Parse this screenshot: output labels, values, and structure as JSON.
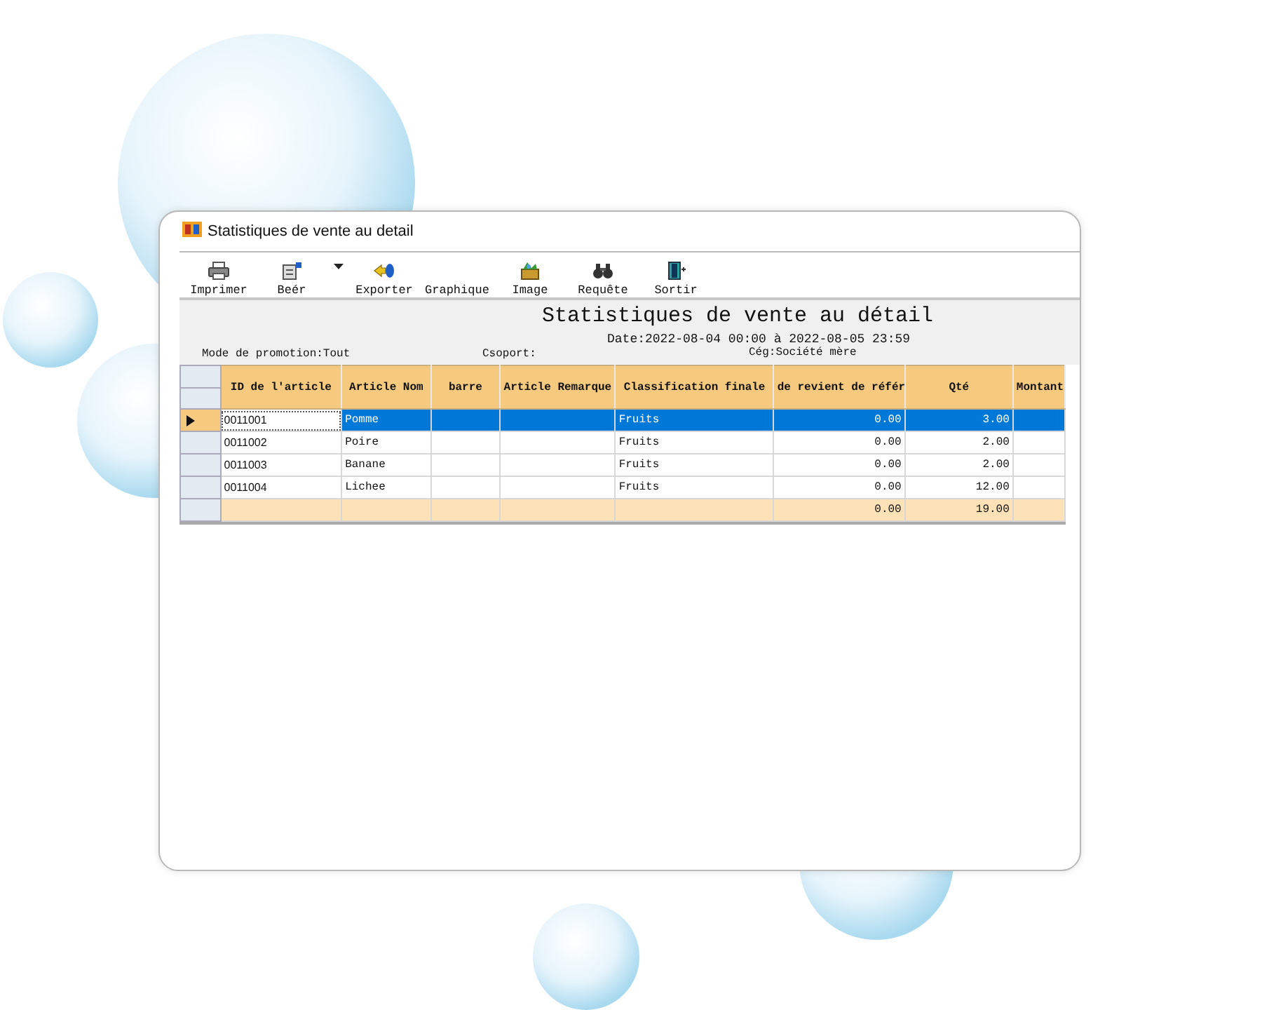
{
  "window": {
    "title": "Statistiques de vente au detail"
  },
  "toolbar": [
    {
      "label": "Imprimer",
      "kind": "printer",
      "dropdown": false
    },
    {
      "label": "Beér",
      "kind": "document",
      "dropdown": true
    },
    {
      "label": "Exporter",
      "kind": "export",
      "dropdown": false
    },
    {
      "label": "Graphique",
      "kind": "none",
      "dropdown": false
    },
    {
      "label": "Image",
      "kind": "picture-box",
      "dropdown": false
    },
    {
      "label": "Requête",
      "kind": "binoculars",
      "dropdown": false
    },
    {
      "label": "Sortir",
      "kind": "door",
      "dropdown": false
    }
  ],
  "report": {
    "title": "Statistiques de vente au détail",
    "date": "Date:2022-08-04 00:00 à 2022-08-05 23:59",
    "filters": [
      "Mode de promotion:Tout",
      "Csoport:",
      "Cég:Société mère"
    ]
  },
  "table": {
    "columns": [
      {
        "label": "ID de l'article",
        "kind": "text"
      },
      {
        "label": "Article Nom",
        "kind": "text"
      },
      {
        "label": "barre",
        "kind": "text"
      },
      {
        "label": "Article Remarque",
        "kind": "text"
      },
      {
        "label": "Classification finale",
        "kind": "text"
      },
      {
        "label": "de revient de référ",
        "kind": "number"
      },
      {
        "label": "Qté",
        "kind": "number"
      },
      {
        "label": "Montant",
        "kind": "number"
      }
    ],
    "rows": [
      {
        "id": "0011001",
        "name": "Pomme",
        "category": "Fruits",
        "cost": "0.00",
        "qty": "3.00",
        "selected": true
      },
      {
        "id": "0011002",
        "name": "Poire",
        "category": "Fruits",
        "cost": "0.00",
        "qty": "2.00",
        "selected": false
      },
      {
        "id": "0011003",
        "name": "Banane",
        "category": "Fruits",
        "cost": "0.00",
        "qty": "2.00",
        "selected": false
      },
      {
        "id": "0011004",
        "name": "Lichee",
        "category": "Fruits",
        "cost": "0.00",
        "qty": "12.00",
        "selected": false
      }
    ],
    "total": {
      "cost": "0.00",
      "qty": "19.00"
    }
  }
}
